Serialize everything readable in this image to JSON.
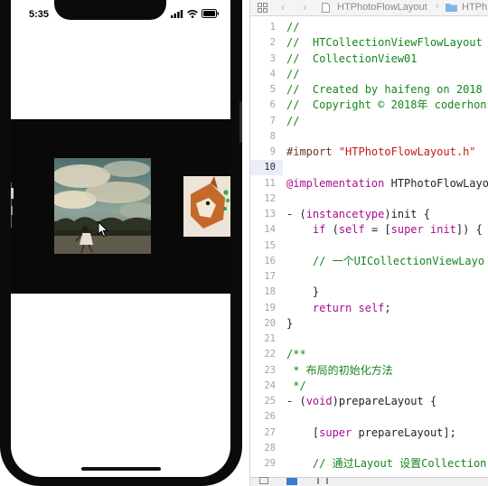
{
  "simulator": {
    "status_time": "5:35",
    "icons": [
      "signal-icon",
      "wifi-icon",
      "battery-icon"
    ],
    "colors": {
      "bezel": "#0b0b0b",
      "collection_bg": "#090909"
    }
  },
  "editor": {
    "breadcrumb": {
      "file": "HTPhotoFlowLayout",
      "next": "HTPh"
    },
    "lines": [
      {
        "n": "1",
        "tokens": [
          {
            "t": "//",
            "c": "comment"
          }
        ]
      },
      {
        "n": "2",
        "tokens": [
          {
            "t": "//  HTCollectionViewFlowLayout",
            "c": "comment"
          }
        ]
      },
      {
        "n": "3",
        "tokens": [
          {
            "t": "//  CollectionView01",
            "c": "comment"
          }
        ]
      },
      {
        "n": "4",
        "tokens": [
          {
            "t": "//",
            "c": "comment"
          }
        ]
      },
      {
        "n": "5",
        "tokens": [
          {
            "t": "//  Created by haifeng on 2018",
            "c": "comment"
          }
        ]
      },
      {
        "n": "6",
        "tokens": [
          {
            "t": "//  Copyright © 2018年 coderhon",
            "c": "comment"
          }
        ]
      },
      {
        "n": "7",
        "tokens": [
          {
            "t": "//",
            "c": "comment"
          }
        ]
      },
      {
        "n": "8",
        "tokens": []
      },
      {
        "n": "9",
        "tokens": [
          {
            "t": "#import ",
            "c": "macro"
          },
          {
            "t": "\"HTPhotoFlowLayout.h\"",
            "c": "string"
          }
        ]
      },
      {
        "n": "10",
        "tokens": [],
        "current": true
      },
      {
        "n": "11",
        "tokens": [
          {
            "t": "@implementation",
            "c": "keyword"
          },
          {
            "t": " HTPhotoFlowLayo",
            "c": "plain"
          }
        ]
      },
      {
        "n": "12",
        "tokens": []
      },
      {
        "n": "13",
        "tokens": [
          {
            "t": "- (",
            "c": "plain"
          },
          {
            "t": "instancetype",
            "c": "keyword"
          },
          {
            "t": ")init {",
            "c": "plain"
          }
        ]
      },
      {
        "n": "14",
        "tokens": [
          {
            "t": "    ",
            "c": "plain"
          },
          {
            "t": "if",
            "c": "keyword"
          },
          {
            "t": " (",
            "c": "plain"
          },
          {
            "t": "self",
            "c": "keyword"
          },
          {
            "t": " = [",
            "c": "plain"
          },
          {
            "t": "super",
            "c": "keyword"
          },
          {
            "t": " ",
            "c": "plain"
          },
          {
            "t": "init",
            "c": "keyword"
          },
          {
            "t": "]) {",
            "c": "plain"
          }
        ]
      },
      {
        "n": "15",
        "tokens": []
      },
      {
        "n": "16",
        "tokens": [
          {
            "t": "    // 一个UICollectionViewLayo",
            "c": "comment"
          }
        ]
      },
      {
        "n": "17",
        "tokens": []
      },
      {
        "n": "18",
        "tokens": [
          {
            "t": "    }",
            "c": "plain"
          }
        ]
      },
      {
        "n": "19",
        "tokens": [
          {
            "t": "    ",
            "c": "plain"
          },
          {
            "t": "return",
            "c": "keyword"
          },
          {
            "t": " ",
            "c": "plain"
          },
          {
            "t": "self",
            "c": "keyword"
          },
          {
            "t": ";",
            "c": "plain"
          }
        ]
      },
      {
        "n": "20",
        "tokens": [
          {
            "t": "}",
            "c": "plain"
          }
        ]
      },
      {
        "n": "21",
        "tokens": []
      },
      {
        "n": "22",
        "tokens": [
          {
            "t": "/**",
            "c": "comment"
          }
        ]
      },
      {
        "n": "23",
        "tokens": [
          {
            "t": " * 布局的初始化方法",
            "c": "comment"
          }
        ]
      },
      {
        "n": "24",
        "tokens": [
          {
            "t": " */",
            "c": "comment"
          }
        ]
      },
      {
        "n": "25",
        "tokens": [
          {
            "t": "- (",
            "c": "plain"
          },
          {
            "t": "void",
            "c": "keyword"
          },
          {
            "t": ")prepareLayout {",
            "c": "plain"
          }
        ]
      },
      {
        "n": "26",
        "tokens": []
      },
      {
        "n": "27",
        "tokens": [
          {
            "t": "    [",
            "c": "plain"
          },
          {
            "t": "super",
            "c": "keyword"
          },
          {
            "t": " prepareLayout];",
            "c": "plain"
          }
        ]
      },
      {
        "n": "28",
        "tokens": []
      },
      {
        "n": "29",
        "tokens": [
          {
            "t": "    // 通过Layout 设置Collection",
            "c": "comment"
          }
        ]
      }
    ]
  }
}
